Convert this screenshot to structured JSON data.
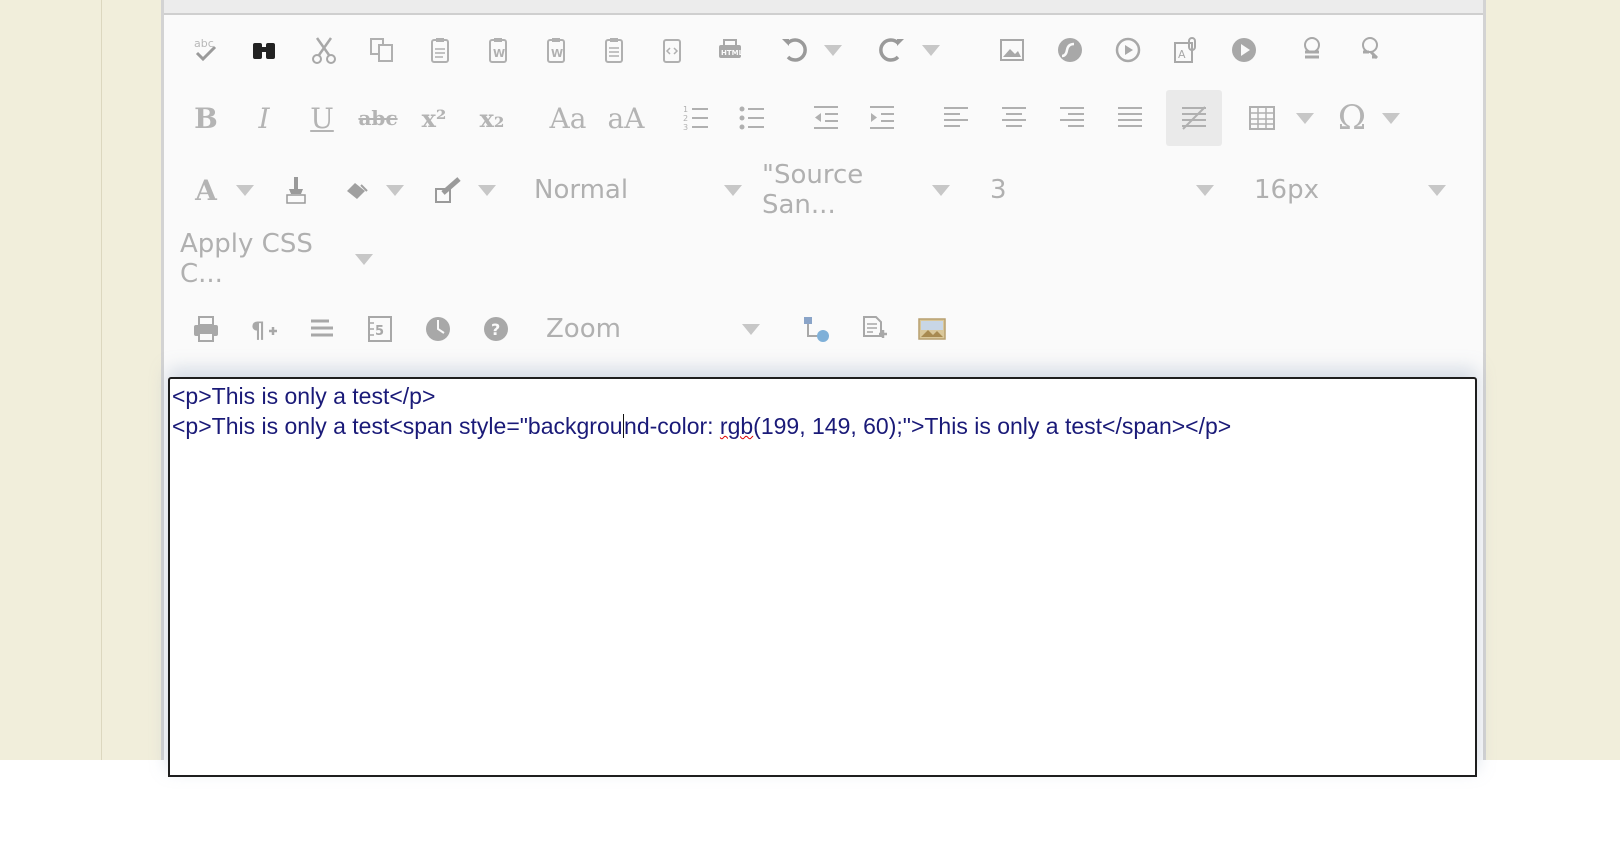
{
  "toolbar": {
    "row1": [
      {
        "name": "spellcheck-icon",
        "kind": "icon"
      },
      {
        "name": "find-binoculars-icon",
        "kind": "icon"
      },
      {
        "name": "cut-icon",
        "kind": "icon"
      },
      {
        "name": "copy-icon",
        "kind": "icon"
      },
      {
        "name": "paste-icon",
        "kind": "icon"
      },
      {
        "name": "paste-word-icon",
        "kind": "icon"
      },
      {
        "name": "paste-word-alt-icon",
        "kind": "icon"
      },
      {
        "name": "paste-text-icon",
        "kind": "icon"
      },
      {
        "name": "paste-code-icon",
        "kind": "icon"
      },
      {
        "name": "paste-html-icon",
        "kind": "icon"
      },
      {
        "name": "undo-icon",
        "kind": "icon"
      },
      {
        "name": "redo-icon",
        "kind": "icon"
      },
      {
        "name": "insert-image-icon",
        "kind": "icon"
      },
      {
        "name": "insert-flash-icon",
        "kind": "icon"
      },
      {
        "name": "insert-media-icon",
        "kind": "icon"
      },
      {
        "name": "insert-document-icon",
        "kind": "icon"
      },
      {
        "name": "insert-video-icon",
        "kind": "icon"
      },
      {
        "name": "insert-link-icon",
        "kind": "icon"
      },
      {
        "name": "remove-link-icon",
        "kind": "icon"
      }
    ],
    "row2": {
      "bold": "B",
      "italic": "I",
      "underline": "U",
      "strikethrough": "abc",
      "superscript": "x²",
      "subscript": "x₂",
      "lowercase": "Aa",
      "uppercase": "aA",
      "omega": "Ω"
    },
    "row3": {
      "font_color": "A",
      "paragraph_format": "Normal",
      "font_name": "\"Source San...",
      "font_size": "3",
      "real_font_size": "16px"
    },
    "row4": {
      "css_class": "Apply CSS C..."
    },
    "row5": {
      "zoom": "Zoom"
    }
  },
  "editor": {
    "line1": "<p>This is only a test</p>",
    "line2_before_caret": "<p>This is only a test<span style=\"backgrou",
    "line2_after_caret_before_rgb": "nd-color: ",
    "line2_misspelled": "rgb",
    "line2_rest": "(199, 149, 60);\">This is only a test</span></p>"
  },
  "colors": {
    "page_background": "#f1eedb",
    "toolbar_background": "#fafafa",
    "code_text": "#1a1a78",
    "icon_gray": "#b8b8b8"
  }
}
